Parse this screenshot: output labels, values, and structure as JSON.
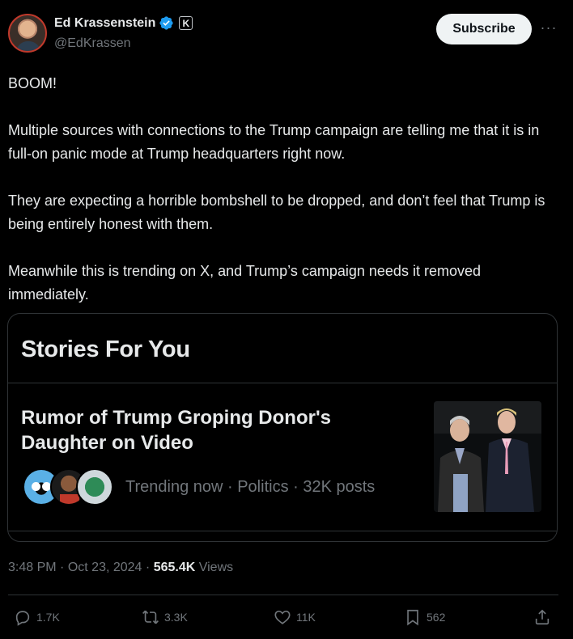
{
  "author": {
    "display_name": "Ed Krassenstein",
    "handle": "@EdKrassen",
    "verified_color": "#1d9bf0"
  },
  "header": {
    "subscribe_label": "Subscribe",
    "affiliate_badge": "K",
    "more_icon": "more-horizontal-icon"
  },
  "post": {
    "paragraphs": [
      "BOOM!",
      "Multiple sources with connections to the Trump campaign are telling me that it is in full-on panic mode at Trump headquarters right now.",
      "They are expecting a horrible bombshell to be dropped, and don’t feel that Trump is being entirely honest with them.",
      "Meanwhile this is trending on X, and Trump’s campaign needs it removed immediately."
    ]
  },
  "card": {
    "title": "Stories For You",
    "headline": "Rumor of Trump Groping Donor's Daughter on Video",
    "trending_text": "Trending now · Politics · 32K posts"
  },
  "meta": {
    "time": "3:48 PM",
    "date": "Oct 23, 2024",
    "views_count": "565.4K",
    "views_label": "Views"
  },
  "actions": {
    "replies": "1.7K",
    "reposts": "3.3K",
    "likes": "11K",
    "bookmarks": "562"
  }
}
